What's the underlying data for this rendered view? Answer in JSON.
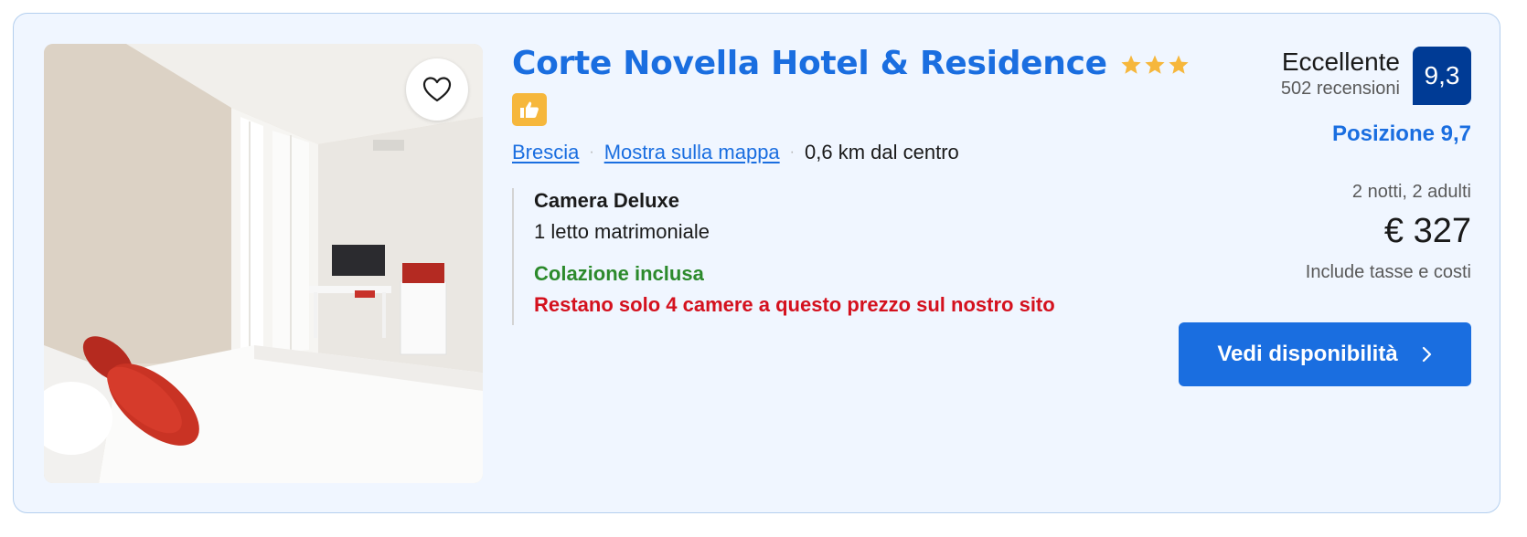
{
  "hotel": {
    "name": "Corte Novella Hotel & Residence",
    "star_rating": 3,
    "city": "Brescia",
    "map_link": "Mostra sulla mappa",
    "distance": "0,6 km dal centro"
  },
  "room": {
    "type": "Camera Deluxe",
    "bed": "1 letto matrimoniale",
    "breakfast": "Colazione inclusa",
    "scarcity": "Restano solo 4 camere a questo prezzo sul nostro sito"
  },
  "review": {
    "word": "Eccellente",
    "count": "502 recensioni",
    "score": "9,3",
    "location_score": "Posizione 9,7"
  },
  "pricing": {
    "stay": "2 notti, 2 adulti",
    "price": "€ 327",
    "taxes": "Include tasse e costi"
  },
  "cta": {
    "label": "Vedi disponibilità"
  },
  "icons": {
    "favorite": "heart-icon",
    "star": "star-icon",
    "thumb": "thumbs-up-icon",
    "chevron": "chevron-right-icon"
  },
  "colors": {
    "accent": "#1a6ee0",
    "card_bg": "#f0f6ff",
    "score_bg": "#003b95",
    "star": "#f6b73c",
    "positive": "#2c8a2c",
    "urgent": "#d4111e"
  }
}
